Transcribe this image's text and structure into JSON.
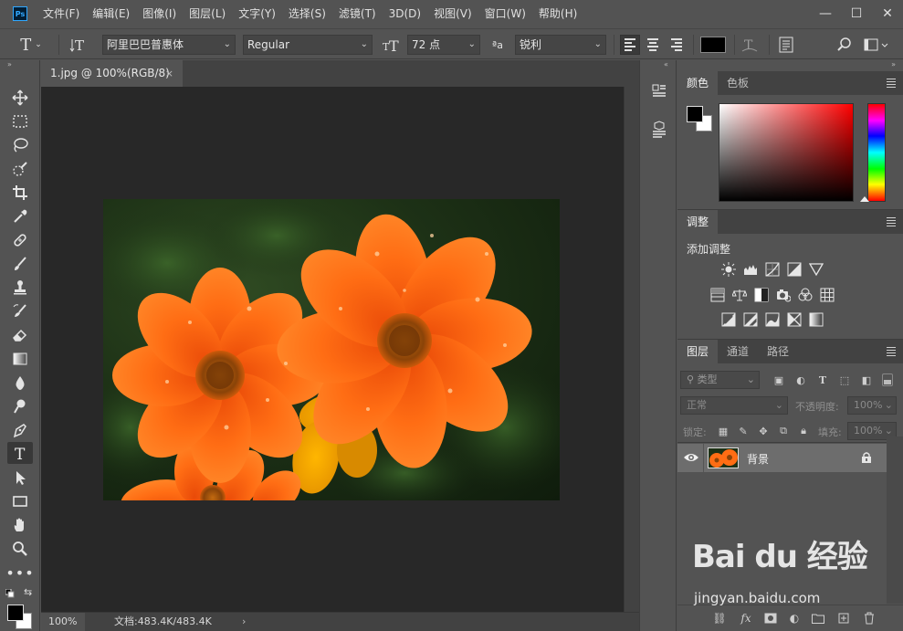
{
  "app": {
    "logo_text": "Ps"
  },
  "menu": [
    "文件(F)",
    "编辑(E)",
    "图像(I)",
    "图层(L)",
    "文字(Y)",
    "选择(S)",
    "滤镜(T)",
    "3D(D)",
    "视图(V)",
    "窗口(W)",
    "帮助(H)"
  ],
  "window_controls": {
    "minimize": "—",
    "maximize": "☐",
    "close": "✕"
  },
  "options": {
    "font_family": "阿里巴巴普惠体",
    "font_style": "Regular",
    "font_size": "72 点",
    "antialias_label": "ªa",
    "antialias": "锐利",
    "text_color": "#000000"
  },
  "document": {
    "tab_title": "1.jpg @ 100%(RGB/8)",
    "close": "×",
    "zoom": "100%",
    "doc_info": "文档:483.4K/483.4K",
    "status_arrow": "›"
  },
  "colors": {
    "foreground": "#000000",
    "background": "#ffffff",
    "accent_flower": "#ff6a10"
  },
  "color_panel": {
    "tabs": [
      "颜色",
      "色板"
    ]
  },
  "adjustments_panel": {
    "tabs": [
      "调整"
    ],
    "heading": "添加调整"
  },
  "layers_panel": {
    "tabs": [
      "图层",
      "通道",
      "路径"
    ],
    "filter_kind": "类型",
    "blend_mode": "正常",
    "opacity_label": "不透明度:",
    "opacity_value": "100%",
    "lock_label": "锁定:",
    "fill_label": "填充:",
    "fill_value": "100%",
    "layers": [
      {
        "name": "背景",
        "visible": true,
        "locked": true
      }
    ]
  },
  "watermark": {
    "brand": "Bai du 经验",
    "url": "jingyan.baidu.com"
  }
}
